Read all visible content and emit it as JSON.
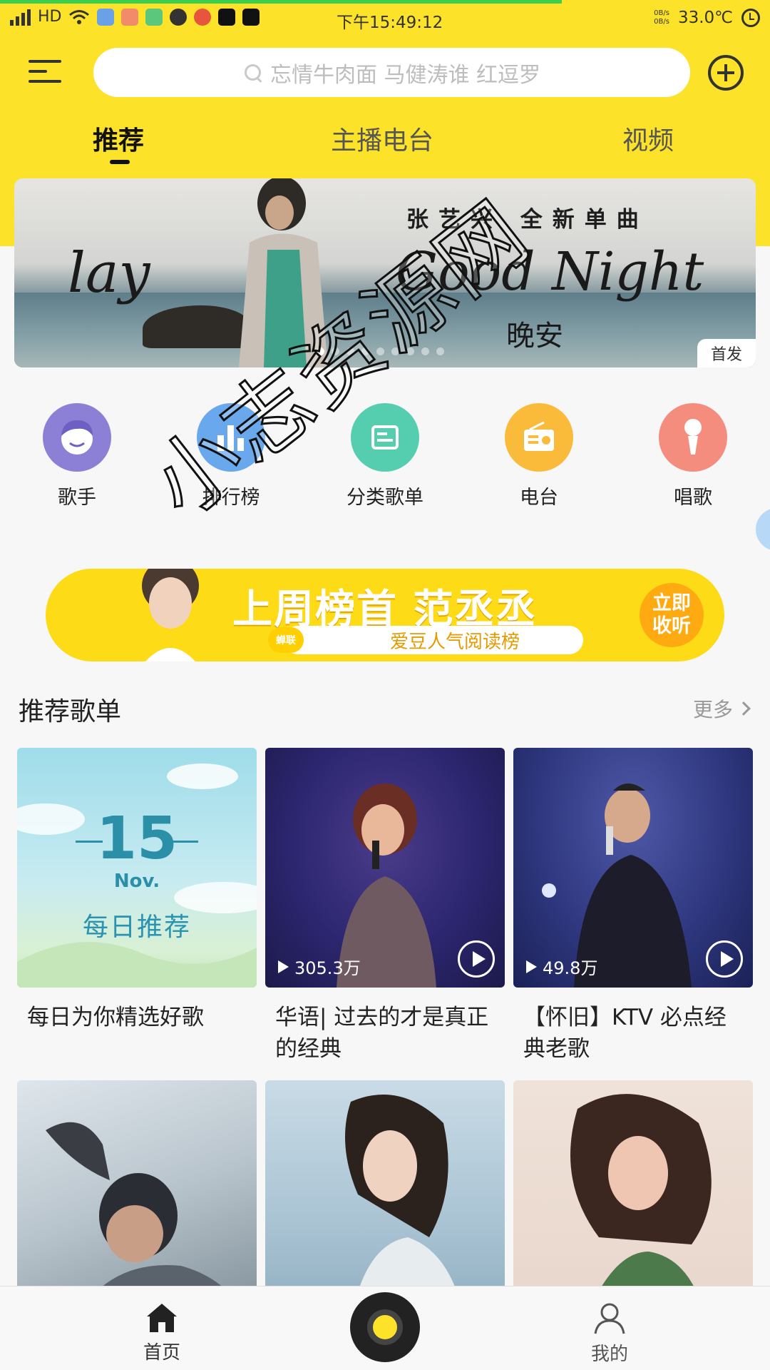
{
  "status_bar": {
    "network": "HD",
    "time": "下午15:49:12",
    "speed_up": "0B/s",
    "speed_down": "0B/s",
    "temperature": "33.0℃"
  },
  "header": {
    "search_placeholder": "忘情牛肉面 马健涛谁 红逗罗",
    "tabs": [
      {
        "label": "推荐",
        "active": true
      },
      {
        "label": "主播电台",
        "active": false
      },
      {
        "label": "视频",
        "active": false
      }
    ],
    "accent_color": "#fde22a"
  },
  "banner": {
    "title": "张艺兴 全新单曲",
    "script_left": "lay",
    "script_right": "Good Night",
    "subtitle": "晚安",
    "tag": "首发",
    "slide_count": 9,
    "active_slide": 0
  },
  "categories": [
    {
      "label": "歌手",
      "icon": "singer-icon",
      "color": "#8b7fd6"
    },
    {
      "label": "排行榜",
      "icon": "chart-bars-icon",
      "color": "#6aa8ee"
    },
    {
      "label": "分类歌单",
      "icon": "playlist-icon",
      "color": "#54ceae"
    },
    {
      "label": "电台",
      "icon": "radio-icon",
      "color": "#fbbb3a"
    },
    {
      "label": "唱歌",
      "icon": "microphone-icon",
      "color": "#f58d7e"
    }
  ],
  "promo": {
    "title": "上周榜首 范丞丞",
    "logo_text": "蝉联",
    "subtitle": "爱豆人气阅读榜",
    "button": "立即收听"
  },
  "recommended": {
    "title": "推荐歌单",
    "more": "更多",
    "daily": {
      "day": "15",
      "month": "Nov.",
      "label": "每日推荐"
    },
    "playlists": [
      {
        "title": "每日为你精选好歌",
        "play_count": ""
      },
      {
        "title": "华语| 过去的才是真正的经典",
        "play_count": "305.3万"
      },
      {
        "title": "【怀旧】KTV 必点经典老歌",
        "play_count": "49.8万"
      },
      {
        "title": "",
        "play_count": ""
      },
      {
        "title": "",
        "play_count": ""
      },
      {
        "title": "",
        "play_count": ""
      }
    ]
  },
  "bottom_nav": [
    {
      "label": "首页",
      "icon": "home-icon",
      "active": true
    },
    {
      "label": "我的",
      "icon": "user-icon",
      "active": false
    }
  ],
  "watermark": "小志资源网"
}
